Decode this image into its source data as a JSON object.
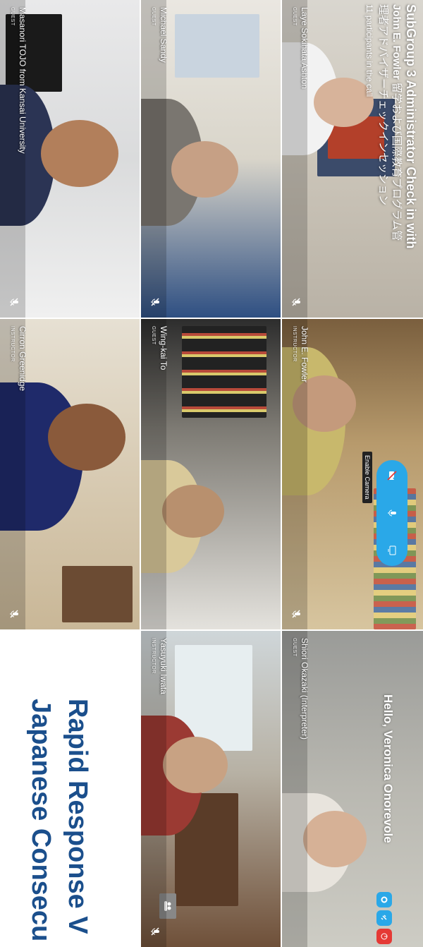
{
  "header": {
    "title": "SubGroup 3 Administrator Check in with",
    "subtitle_bold": "John E. Fowler",
    "subtitle_rest": " 留学および国際教育プログラム管",
    "subtitle_line2": "理者アドバイザーチェックインセッション",
    "participants": "11 participants in the call"
  },
  "participants": [
    {
      "name": "Laye Sokihata Ashton",
      "role": "GUEST",
      "muted": true
    },
    {
      "name": "John E. Fowler",
      "role": "INSTRUCTOR",
      "muted": true
    },
    {
      "name": "Shiori Okazaki (Interpreter)",
      "role": "GUEST",
      "muted": false,
      "active": true
    },
    {
      "name": "Michael Sandy",
      "role": "GUEST",
      "muted": true
    },
    {
      "name": "Wing-kai To",
      "role": "GUEST",
      "muted": false
    },
    {
      "name": "Yasuyuki Iwata",
      "role": "INSTRUCTOR",
      "muted": true
    },
    {
      "name": "Masanori TOJO from Kansai University",
      "role": "GUEST",
      "muted": true
    },
    {
      "name": "Cirron Greenidge",
      "role": "INSTRUCTOR",
      "muted": true
    }
  ],
  "controls": {
    "tooltip": "Enable Camera"
  },
  "greeting": "Hello, Veronica Onorevole",
  "slide": {
    "line1": "Rapid Response V",
    "line2": "Japanese Consecu"
  },
  "colors": {
    "accent": "#2aa8e8",
    "active_border": "#7ed321",
    "slide_text": "#1b4f8c",
    "danger": "#e53935"
  },
  "icons": [
    "mic-off-icon",
    "mic-icon",
    "camera-off-icon",
    "screen-share-icon",
    "gear-icon",
    "link-icon",
    "exit-icon",
    "hand-icon",
    "people-icon"
  ]
}
